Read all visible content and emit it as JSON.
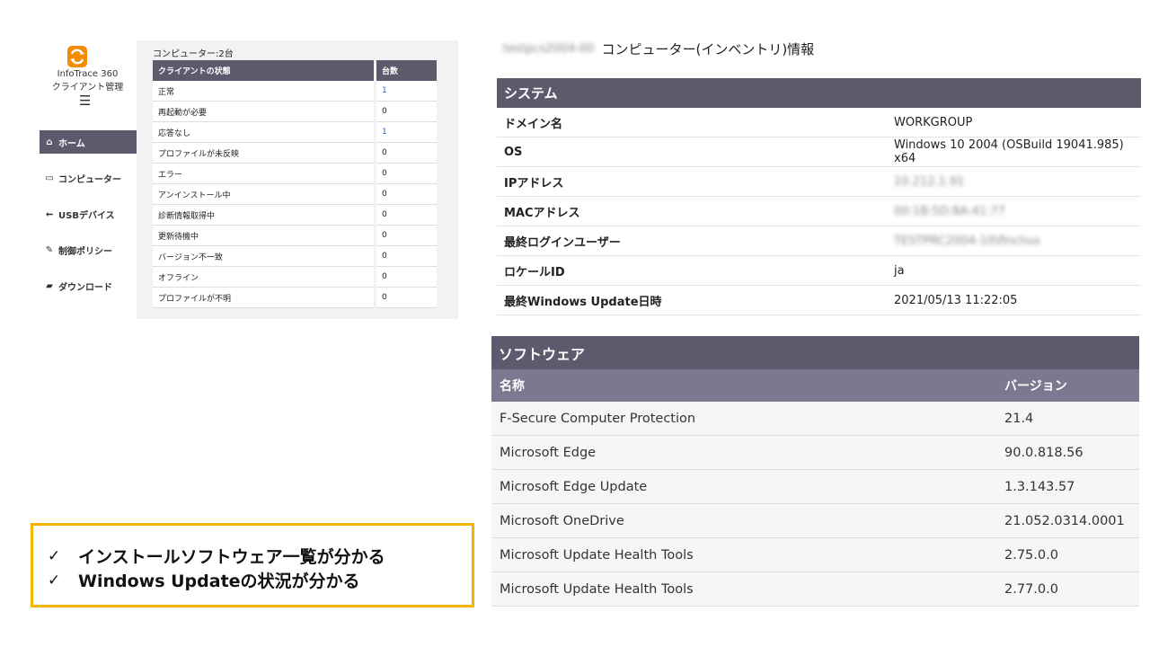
{
  "nav": {
    "brand_line1": "InfoTrace 360",
    "brand_line2": "クライアント管理",
    "menu_icon": "hamburger-icon",
    "items": [
      {
        "label": "ホーム",
        "icon": "home-icon",
        "glyph": "⌂",
        "active": true
      },
      {
        "label": "コンピューター",
        "icon": "monitor-icon",
        "glyph": "▭",
        "active": false
      },
      {
        "label": "USBデバイス",
        "icon": "usb-icon",
        "glyph": "⭠",
        "active": false
      },
      {
        "label": "制御ポリシー",
        "icon": "wrench-icon",
        "glyph": "✎",
        "active": false
      },
      {
        "label": "ダウンロード",
        "icon": "folder-icon",
        "glyph": "▰",
        "active": false
      }
    ]
  },
  "status": {
    "count_label": "コンピューター:2台",
    "headers": [
      "クライアントの状態",
      "台数"
    ],
    "rows": [
      {
        "state": "正常",
        "count": "1",
        "link": true
      },
      {
        "state": "再起動が必要",
        "count": "0",
        "link": false
      },
      {
        "state": "応答なし",
        "count": "1",
        "link": true
      },
      {
        "state": "プロファイルが未反映",
        "count": "0",
        "link": false
      },
      {
        "state": "エラー",
        "count": "0",
        "link": false
      },
      {
        "state": "アンインストール中",
        "count": "0",
        "link": false
      },
      {
        "state": "診断情報取得中",
        "count": "0",
        "link": false
      },
      {
        "state": "更新待機中",
        "count": "0",
        "link": false
      },
      {
        "state": "バージョン不一致",
        "count": "0",
        "link": false
      },
      {
        "state": "オフライン",
        "count": "0",
        "link": false
      },
      {
        "state": "プロファイルが不明",
        "count": "0",
        "link": false
      }
    ]
  },
  "inventory": {
    "computer_name": "testpcs2004-00",
    "title": "コンピューター(インベントリ)情報",
    "system_header": "システム",
    "system_rows": [
      {
        "key": "ドメイン名",
        "value": "WORKGROUP",
        "blurred": false
      },
      {
        "key": "OS",
        "value": "Windows 10 2004 (OSBuild 19041.985) x64",
        "blurred": false
      },
      {
        "key": "IPアドレス",
        "value": "10.212.1.91",
        "blurred": true
      },
      {
        "key": "MACアドレス",
        "value": "00:1B:5D:8A:41:77",
        "blurred": true
      },
      {
        "key": "最終ログインユーザー",
        "value": "TESTPRC2004-10\\finchus",
        "blurred": true
      },
      {
        "key": "ロケールID",
        "value": "ja",
        "blurred": false
      },
      {
        "key": "最終Windows Update日時",
        "value": "2021/05/13 11:22:05",
        "blurred": false
      }
    ],
    "software_header": "ソフトウェア",
    "software_columns": [
      "名称",
      "バージョン"
    ],
    "software_rows": [
      {
        "name": "F-Secure Computer Protection",
        "version": "21.4"
      },
      {
        "name": "Microsoft Edge",
        "version": "90.0.818.56"
      },
      {
        "name": "Microsoft Edge Update",
        "version": "1.3.143.57"
      },
      {
        "name": "Microsoft OneDrive",
        "version": "21.052.0314.0001"
      },
      {
        "name": "Microsoft Update Health Tools",
        "version": "2.75.0.0"
      },
      {
        "name": "Microsoft Update Health Tools",
        "version": "2.77.0.0"
      }
    ]
  },
  "callout": {
    "check_glyph": "✓",
    "lines": [
      "インストールソフトウェア一覧が分かる",
      "Windows Updateの状況が分かる"
    ]
  },
  "colors": {
    "header_bg": "#5e5a6e",
    "subheader_bg": "#7b7890",
    "callout_border": "#f4b400",
    "link": "#2a6ad0"
  }
}
